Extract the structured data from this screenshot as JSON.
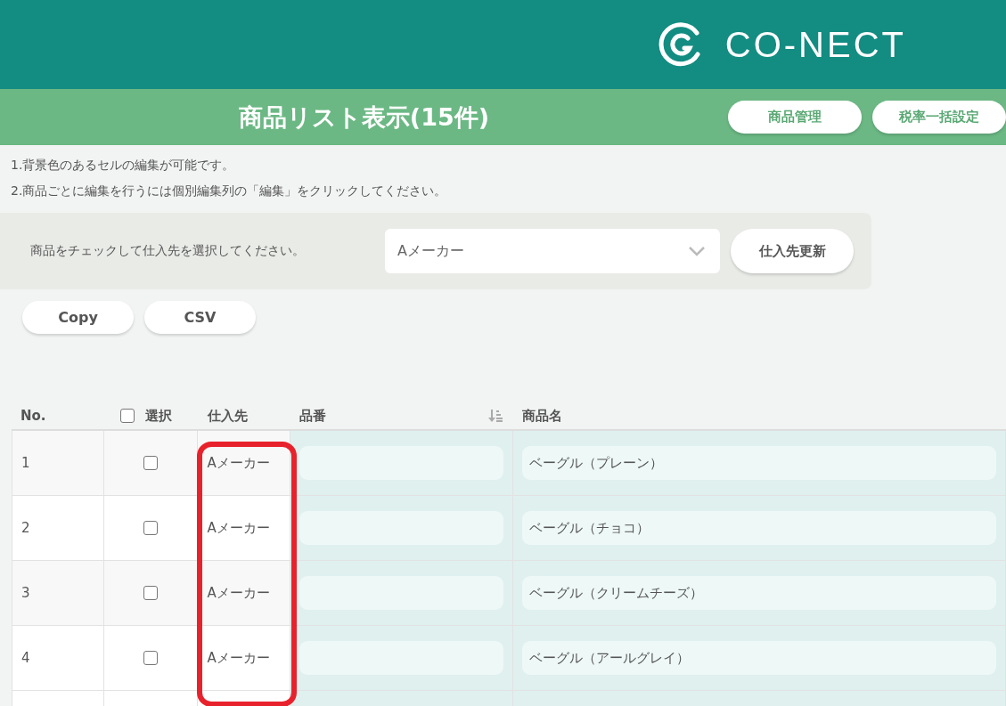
{
  "header": {
    "logo": "CO-NECT"
  },
  "title_bar": {
    "title": "商品リスト表示(15件)",
    "buttons": [
      "商品管理",
      "税率一括設定"
    ]
  },
  "notes": [
    "1.背景色のあるセルの編集が可能です。",
    "2.商品ごとに編集を行うには個別編集列の「編集」をクリックしてください。"
  ],
  "supplier_panel": {
    "label": "商品をチェックして仕入先を選択してください。",
    "select_value": "Aメーカー",
    "button": "仕入先更新"
  },
  "actions": [
    "Copy",
    "CSV"
  ],
  "table": {
    "columns": [
      "No.",
      "選択",
      "仕入先",
      "品番",
      "商品名"
    ],
    "select_all_checked": false,
    "rows": [
      {
        "no": "1",
        "checked": false,
        "supplier": "Aメーカー",
        "code": "",
        "name": "ベーグル（プレーン）"
      },
      {
        "no": "2",
        "checked": false,
        "supplier": "Aメーカー",
        "code": "",
        "name": "ベーグル（チョコ）"
      },
      {
        "no": "3",
        "checked": false,
        "supplier": "Aメーカー",
        "code": "",
        "name": "ベーグル（クリームチーズ）"
      },
      {
        "no": "4",
        "checked": false,
        "supplier": "Aメーカー",
        "code": "",
        "name": "ベーグル（アールグレイ）"
      }
    ]
  }
}
